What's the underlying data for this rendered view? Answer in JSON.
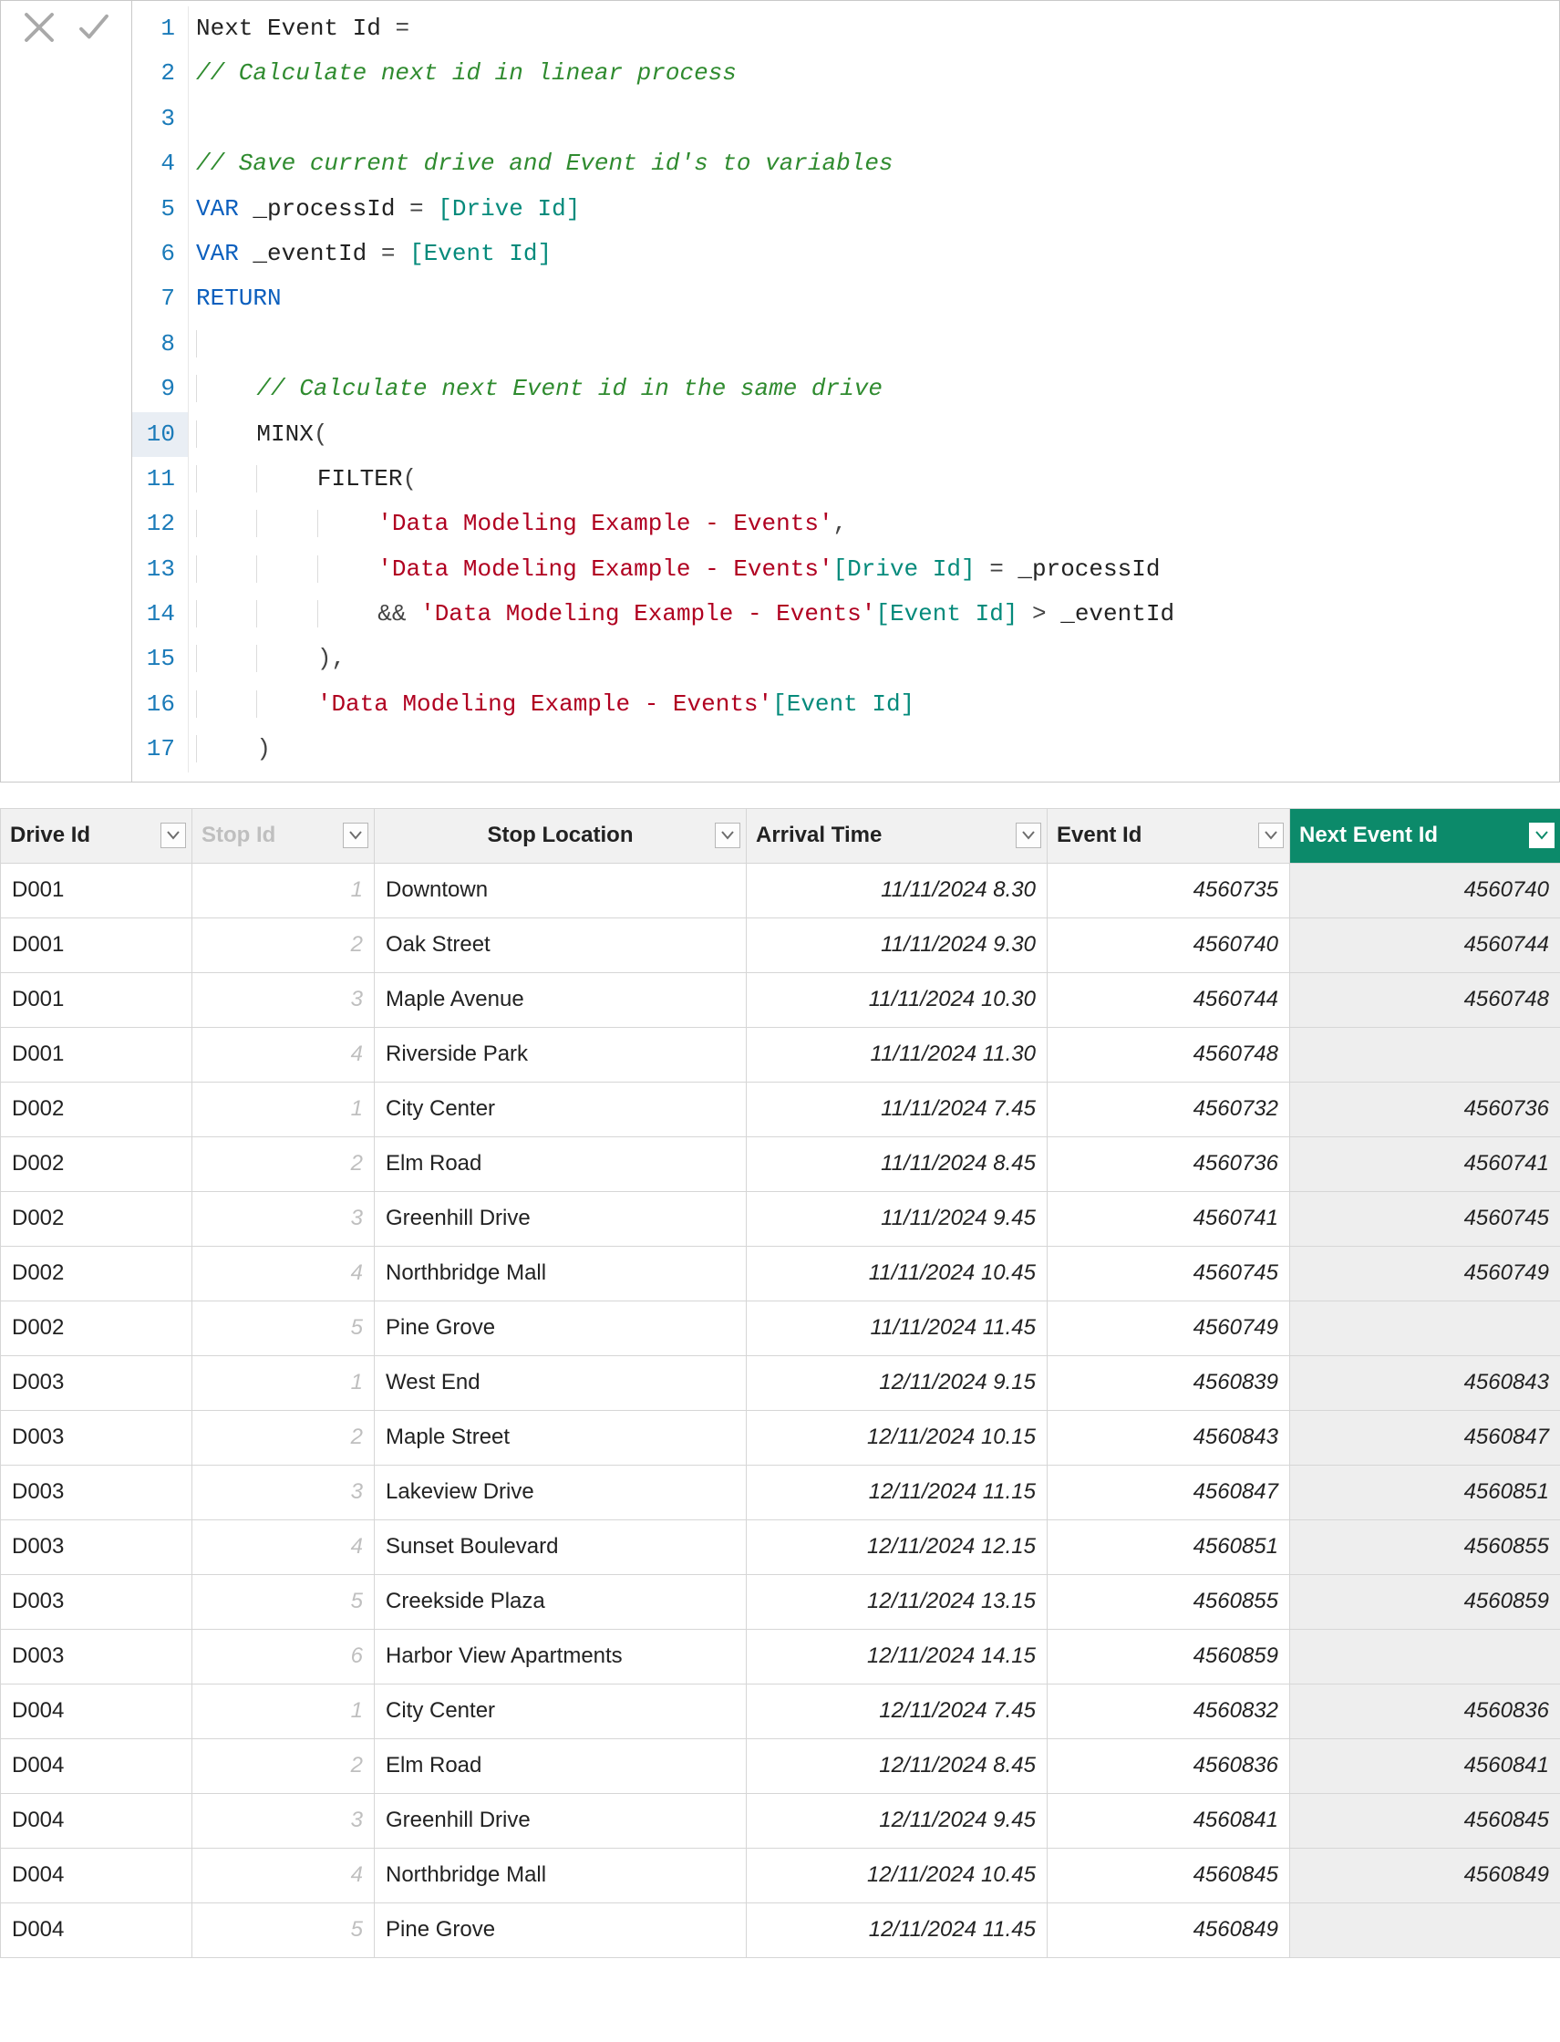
{
  "formula": {
    "lines": [
      [
        {
          "t": "txt",
          "v": "Next Event Id "
        },
        {
          "t": "op",
          "v": "="
        }
      ],
      [
        {
          "t": "com",
          "v": "// Calculate next id in linear process"
        }
      ],
      [],
      [
        {
          "t": "com",
          "v": "// Save current drive and Event id's to variables"
        }
      ],
      [
        {
          "t": "kw",
          "v": "VAR"
        },
        {
          "t": "txt",
          "v": " _processId "
        },
        {
          "t": "op",
          "v": "= "
        },
        {
          "t": "fld",
          "v": "[Drive Id]"
        }
      ],
      [
        {
          "t": "kw",
          "v": "VAR"
        },
        {
          "t": "txt",
          "v": " _eventId "
        },
        {
          "t": "op",
          "v": "= "
        },
        {
          "t": "fld",
          "v": "[Event Id]"
        }
      ],
      [
        {
          "t": "kw",
          "v": "RETURN"
        }
      ],
      [
        {
          "t": "guide",
          "v": ""
        }
      ],
      [
        {
          "t": "guide",
          "v": ""
        },
        {
          "t": "txt",
          "v": "    "
        },
        {
          "t": "com",
          "v": "// Calculate next Event id in the same drive"
        }
      ],
      [
        {
          "t": "guide",
          "v": ""
        },
        {
          "t": "txt",
          "v": "    "
        },
        {
          "t": "fn",
          "v": "MINX"
        },
        {
          "t": "brk",
          "v": "("
        }
      ],
      [
        {
          "t": "guide",
          "v": ""
        },
        {
          "t": "txt",
          "v": "    "
        },
        {
          "t": "guide",
          "v": ""
        },
        {
          "t": "txt",
          "v": "    "
        },
        {
          "t": "fn",
          "v": "FILTER"
        },
        {
          "t": "brk",
          "v": "("
        }
      ],
      [
        {
          "t": "guide",
          "v": ""
        },
        {
          "t": "txt",
          "v": "    "
        },
        {
          "t": "guide",
          "v": ""
        },
        {
          "t": "txt",
          "v": "    "
        },
        {
          "t": "guide",
          "v": ""
        },
        {
          "t": "txt",
          "v": "    "
        },
        {
          "t": "str",
          "v": "'Data Modeling Example - Events'"
        },
        {
          "t": "brk",
          "v": ","
        }
      ],
      [
        {
          "t": "guide",
          "v": ""
        },
        {
          "t": "txt",
          "v": "    "
        },
        {
          "t": "guide",
          "v": ""
        },
        {
          "t": "txt",
          "v": "    "
        },
        {
          "t": "guide",
          "v": ""
        },
        {
          "t": "txt",
          "v": "    "
        },
        {
          "t": "str",
          "v": "'Data Modeling Example - Events'"
        },
        {
          "t": "fld",
          "v": "[Drive Id]"
        },
        {
          "t": "txt",
          "v": " "
        },
        {
          "t": "op",
          "v": "="
        },
        {
          "t": "txt",
          "v": " _processId"
        }
      ],
      [
        {
          "t": "guide",
          "v": ""
        },
        {
          "t": "txt",
          "v": "    "
        },
        {
          "t": "guide",
          "v": ""
        },
        {
          "t": "txt",
          "v": "    "
        },
        {
          "t": "guide",
          "v": ""
        },
        {
          "t": "txt",
          "v": "    "
        },
        {
          "t": "op",
          "v": "&&"
        },
        {
          "t": "txt",
          "v": " "
        },
        {
          "t": "str",
          "v": "'Data Modeling Example - Events'"
        },
        {
          "t": "fld",
          "v": "[Event Id]"
        },
        {
          "t": "txt",
          "v": " "
        },
        {
          "t": "op",
          "v": ">"
        },
        {
          "t": "txt",
          "v": " _eventId"
        }
      ],
      [
        {
          "t": "guide",
          "v": ""
        },
        {
          "t": "txt",
          "v": "    "
        },
        {
          "t": "guide",
          "v": ""
        },
        {
          "t": "txt",
          "v": "    "
        },
        {
          "t": "brk",
          "v": "),"
        }
      ],
      [
        {
          "t": "guide",
          "v": ""
        },
        {
          "t": "txt",
          "v": "    "
        },
        {
          "t": "guide",
          "v": ""
        },
        {
          "t": "txt",
          "v": "    "
        },
        {
          "t": "str",
          "v": "'Data Modeling Example - Events'"
        },
        {
          "t": "fld",
          "v": "[Event Id]"
        }
      ],
      [
        {
          "t": "guide",
          "v": ""
        },
        {
          "t": "txt",
          "v": "    "
        },
        {
          "t": "brk",
          "v": ")"
        }
      ]
    ],
    "current_line": 10
  },
  "table": {
    "columns": [
      {
        "key": "drive",
        "label": "Drive Id",
        "sel": false,
        "dim": false,
        "center": false
      },
      {
        "key": "stop",
        "label": "Stop Id",
        "sel": false,
        "dim": true,
        "center": false
      },
      {
        "key": "loc",
        "label": "Stop Location",
        "sel": false,
        "dim": false,
        "center": true
      },
      {
        "key": "arr",
        "label": "Arrival Time",
        "sel": false,
        "dim": false,
        "center": false
      },
      {
        "key": "evt",
        "label": "Event Id",
        "sel": false,
        "dim": false,
        "center": false
      },
      {
        "key": "next",
        "label": "Next Event Id",
        "sel": true,
        "dim": false,
        "center": false
      }
    ],
    "rows": [
      {
        "drive": "D001",
        "stop": "1",
        "loc": "Downtown",
        "arr": "11/11/2024 8.30",
        "evt": "4560735",
        "next": "4560740"
      },
      {
        "drive": "D001",
        "stop": "2",
        "loc": "Oak Street",
        "arr": "11/11/2024 9.30",
        "evt": "4560740",
        "next": "4560744"
      },
      {
        "drive": "D001",
        "stop": "3",
        "loc": "Maple Avenue",
        "arr": "11/11/2024 10.30",
        "evt": "4560744",
        "next": "4560748"
      },
      {
        "drive": "D001",
        "stop": "4",
        "loc": "Riverside Park",
        "arr": "11/11/2024 11.30",
        "evt": "4560748",
        "next": ""
      },
      {
        "drive": "D002",
        "stop": "1",
        "loc": "City Center",
        "arr": "11/11/2024 7.45",
        "evt": "4560732",
        "next": "4560736"
      },
      {
        "drive": "D002",
        "stop": "2",
        "loc": "Elm Road",
        "arr": "11/11/2024 8.45",
        "evt": "4560736",
        "next": "4560741"
      },
      {
        "drive": "D002",
        "stop": "3",
        "loc": "Greenhill Drive",
        "arr": "11/11/2024 9.45",
        "evt": "4560741",
        "next": "4560745"
      },
      {
        "drive": "D002",
        "stop": "4",
        "loc": "Northbridge Mall",
        "arr": "11/11/2024 10.45",
        "evt": "4560745",
        "next": "4560749"
      },
      {
        "drive": "D002",
        "stop": "5",
        "loc": "Pine Grove",
        "arr": "11/11/2024 11.45",
        "evt": "4560749",
        "next": ""
      },
      {
        "drive": "D003",
        "stop": "1",
        "loc": "West End",
        "arr": "12/11/2024 9.15",
        "evt": "4560839",
        "next": "4560843"
      },
      {
        "drive": "D003",
        "stop": "2",
        "loc": "Maple Street",
        "arr": "12/11/2024 10.15",
        "evt": "4560843",
        "next": "4560847"
      },
      {
        "drive": "D003",
        "stop": "3",
        "loc": "Lakeview Drive",
        "arr": "12/11/2024 11.15",
        "evt": "4560847",
        "next": "4560851"
      },
      {
        "drive": "D003",
        "stop": "4",
        "loc": "Sunset Boulevard",
        "arr": "12/11/2024 12.15",
        "evt": "4560851",
        "next": "4560855"
      },
      {
        "drive": "D003",
        "stop": "5",
        "loc": "Creekside Plaza",
        "arr": "12/11/2024 13.15",
        "evt": "4560855",
        "next": "4560859"
      },
      {
        "drive": "D003",
        "stop": "6",
        "loc": "Harbor View Apartments",
        "arr": "12/11/2024 14.15",
        "evt": "4560859",
        "next": ""
      },
      {
        "drive": "D004",
        "stop": "1",
        "loc": "City Center",
        "arr": "12/11/2024 7.45",
        "evt": "4560832",
        "next": "4560836"
      },
      {
        "drive": "D004",
        "stop": "2",
        "loc": "Elm Road",
        "arr": "12/11/2024 8.45",
        "evt": "4560836",
        "next": "4560841"
      },
      {
        "drive": "D004",
        "stop": "3",
        "loc": "Greenhill Drive",
        "arr": "12/11/2024 9.45",
        "evt": "4560841",
        "next": "4560845"
      },
      {
        "drive": "D004",
        "stop": "4",
        "loc": "Northbridge Mall",
        "arr": "12/11/2024 10.45",
        "evt": "4560845",
        "next": "4560849"
      },
      {
        "drive": "D004",
        "stop": "5",
        "loc": "Pine Grove",
        "arr": "12/11/2024 11.45",
        "evt": "4560849",
        "next": ""
      }
    ]
  }
}
